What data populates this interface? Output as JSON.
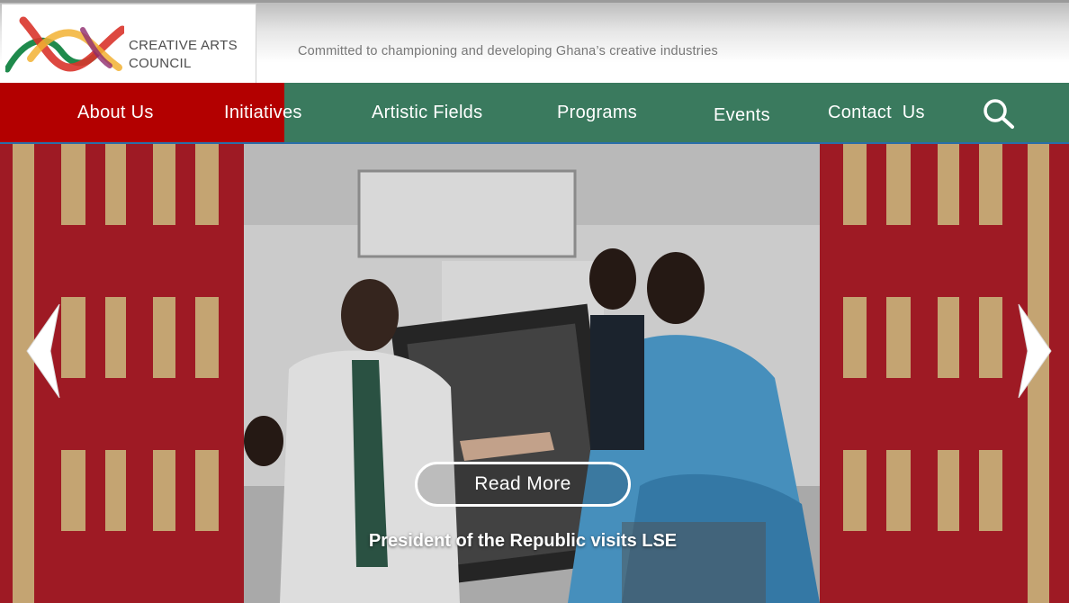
{
  "header": {
    "logo_line1": "CREATIVE ARTS",
    "logo_line2": "COUNCIL",
    "tagline": "Committed to championing and developing Ghana’s creative industries"
  },
  "nav": {
    "items": [
      {
        "label": "About Us"
      },
      {
        "label": "Initiatives"
      },
      {
        "label": "Artistic Fields"
      },
      {
        "label": "Programs"
      },
      {
        "label": "Events"
      },
      {
        "label": "Contact  Us"
      }
    ],
    "search_icon": "search-icon"
  },
  "hero": {
    "button_label": "Read More",
    "caption": "President of the Republic visits LSE",
    "prev_icon": "chevron-left-icon",
    "next_icon": "chevron-right-icon"
  },
  "colors": {
    "nav_green": "#3a7a5e",
    "nav_red": "#b30000",
    "pattern_red": "#9e1a24",
    "pattern_gold": "#c4a472"
  }
}
